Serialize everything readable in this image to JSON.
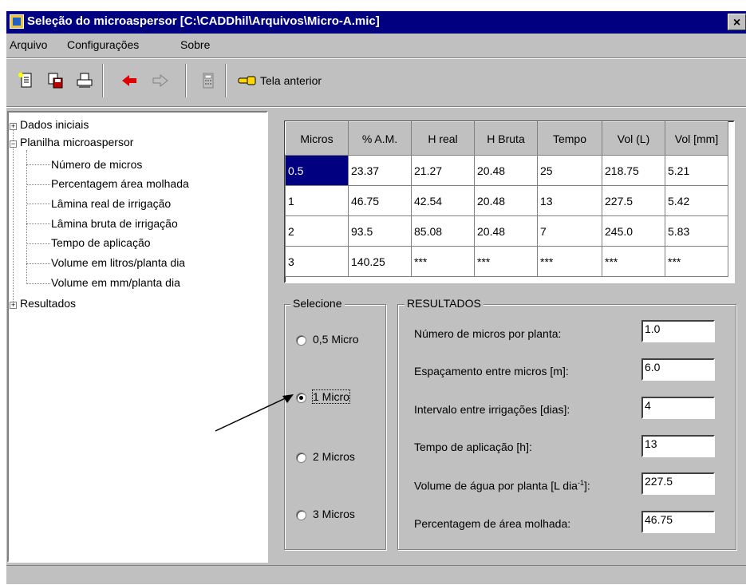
{
  "window": {
    "title": "Seleção do microaspersor [C:\\CADDhil\\Arquivos\\Micro-A.mic]",
    "close_glyph": "×"
  },
  "menu": [
    "Arquivo",
    "Configurações",
    "Sobre"
  ],
  "toolbar": {
    "back_label": "Tela anterior"
  },
  "tree": {
    "nodes": [
      {
        "label": "Dados iniciais",
        "expander": "+"
      },
      {
        "label": "Planilha microaspersor",
        "expander": "−"
      },
      {
        "label": "Resultados",
        "expander": "+"
      }
    ],
    "children": [
      "Número de micros",
      "Percentagem área molhada",
      "Lâmina real de irrigação",
      "Lâmina bruta de irrigação",
      "Tempo de aplicação",
      "Volume em litros/planta dia",
      "Volume em mm/planta dia"
    ]
  },
  "table": {
    "columns": [
      "Micros",
      "% A.M.",
      "H real",
      "H Bruta",
      "Tempo",
      "Vol (L)",
      "Vol [mm]"
    ],
    "rows": [
      [
        "0.5",
        "23.37",
        "21.27",
        "20.48",
        "25",
        "218.75",
        "5.21"
      ],
      [
        "1",
        "46.75",
        "42.54",
        "20.48",
        "13",
        "227.5",
        "5.42"
      ],
      [
        "2",
        "93.5",
        "85.08",
        "20.48",
        "7",
        "245.0",
        "5.83"
      ],
      [
        "3",
        "140.25",
        "***",
        "***",
        "***",
        "***",
        "***"
      ]
    ]
  },
  "selecione": {
    "title": "Selecione",
    "options": [
      "0,5 Micro",
      "1 Micro",
      "2 Micros",
      "3 Micros"
    ],
    "selected_index": 1
  },
  "resultados": {
    "title": "RESULTADOS",
    "fields": [
      {
        "label": "Número de micros por planta:",
        "value": "1.0"
      },
      {
        "label": "Espaçamento entre micros [m]:",
        "value": "6.0"
      },
      {
        "label": "Intervalo entre irrigações [dias]:",
        "value": "4"
      },
      {
        "label": "Tempo de aplicação [h]:",
        "value": "13"
      },
      {
        "label": "Volume de água por planta [L dia",
        "label_sup": "-1",
        "label_tail": "]:",
        "value": "227.5"
      },
      {
        "label": "Percentagem de área molhada:",
        "value": "46.75"
      }
    ]
  }
}
